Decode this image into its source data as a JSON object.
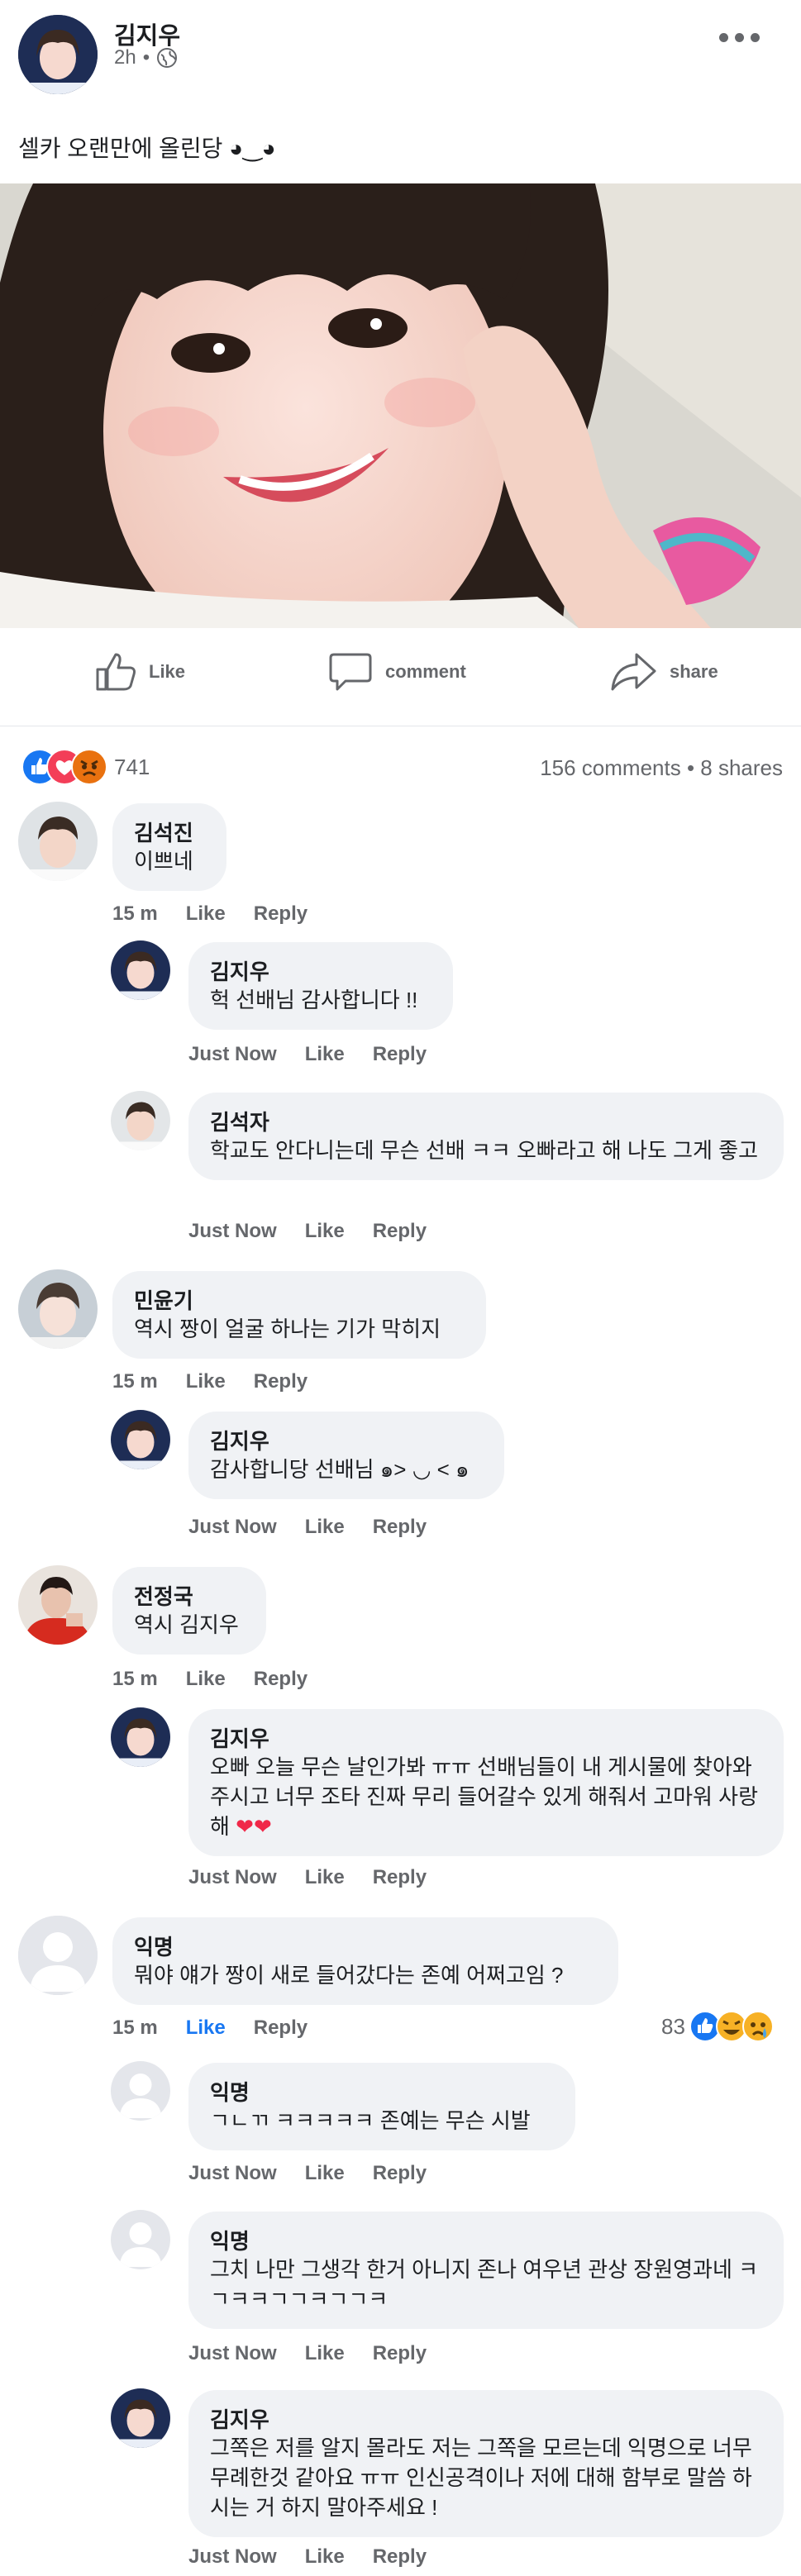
{
  "post": {
    "author": "김지우",
    "time": "2h",
    "dot": "•",
    "text": "셀카 오랜만에 올린당 ◕‿◕"
  },
  "actions": {
    "like": "Like",
    "comment": "comment",
    "share": "share"
  },
  "stats": {
    "reactions_count": "741",
    "comments_shares": "156 comments • 8 shares"
  },
  "comments": [
    {
      "name": "김석진",
      "text": "이쁘네",
      "time": "15 m",
      "like": "Like",
      "reply": "Reply",
      "replies": [
        {
          "name": "김지우",
          "text": "헉 선배님 감사합니다 !!",
          "time": "Just Now",
          "like": "Like",
          "reply": "Reply"
        },
        {
          "name": "김석자",
          "text": "학교도 안다니는데 무슨 선배 ㅋㅋ 오빠라고 해 나도 그게 좋고",
          "time": "Just Now",
          "like": "Like",
          "reply": "Reply"
        }
      ]
    },
    {
      "name": "민윤기",
      "text": "역시 짱이 얼굴 하나는 기가 막히지",
      "time": "15 m",
      "like": "Like",
      "reply": "Reply",
      "replies": [
        {
          "name": "김지우",
          "text": "감사합니당 선배님 ๑> ◡ < ๑",
          "time": "Just Now",
          "like": "Like",
          "reply": "Reply"
        }
      ]
    },
    {
      "name": "전정국",
      "text": "역시 김지우",
      "time": "15 m",
      "like": "Like",
      "reply": "Reply",
      "replies": [
        {
          "name": "김지우",
          "text": "오빠 오늘 무슨 날인가봐 ㅠㅠ 선배님들이 내 게시물에 찾아와주시고 너무 조타 진짜 무리 들어갈수 있게 해줘서 고마워 사랑해 ❤❤",
          "time": "Just Now",
          "like": "Like",
          "reply": "Reply"
        }
      ]
    },
    {
      "name": "익명",
      "text": "뭐야 얘가 짱이 새로 들어갔다는 존예 어쩌고임 ?",
      "time": "15 m",
      "like": "Like",
      "reply": "Reply",
      "reactions": "83",
      "replies": [
        {
          "name": "익명",
          "text": "ㄱㄴㄲ ㅋㅋㅋㅋㅋ 존예는 무슨 시발",
          "time": "Just Now",
          "like": "Like",
          "reply": "Reply"
        },
        {
          "name": "익명",
          "text": "그치 나만 그생각 한거 아니지 존나 여우년 관상 장원영과네 ㅋㄱㅋㅋㄱㄱㅋㄱㄱㅋ",
          "time": "Just Now",
          "like": "Like",
          "reply": "Reply"
        },
        {
          "name": "김지우",
          "text": "그쪽은 저를 알지 몰라도 저는 그쪽을 모르는데 익명으로 너무 무례한것 같아요 ㅠㅠ 인신공격이나 저에 대해 함부로 말씀 하시는 거 하지 말아주세요 !",
          "time": "Just Now",
          "like": "Like",
          "reply": "Reply"
        }
      ]
    }
  ]
}
